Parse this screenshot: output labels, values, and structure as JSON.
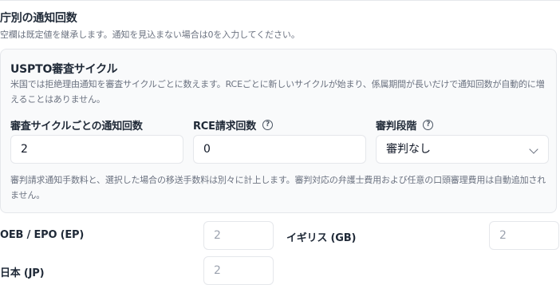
{
  "section": {
    "title": "庁別の通知回数",
    "subtitle": "空欄は既定値を継承します。通知を見込まない場合は0を入力してください。"
  },
  "uspto": {
    "title": "USPTO審査サイクル",
    "description": "米国では拒絶理由通知を審査サイクルごとに数えます。RCEごとに新しいサイクルが始まり、係属期間が長いだけで通知回数が自動的に増えることはありません。",
    "fields": {
      "per_cycle": {
        "label": "審査サイクルごとの通知回数",
        "value": "2"
      },
      "rce": {
        "label": "RCE請求回数",
        "value": "0",
        "help_icon": "question-circle"
      },
      "appeal": {
        "label": "審判段階",
        "selected": "審判なし",
        "help_icon": "question-circle"
      }
    },
    "note": "審判請求通知手数料と、選択した場合の移送手数料は別々に計上します。審判対応の弁護士費用および任意の口頭審理費用は自動追加されません。"
  },
  "offices": [
    {
      "label": "OEB / EPO (EP)",
      "placeholder": "2"
    },
    {
      "label": "イギリス (GB)",
      "placeholder": "2"
    },
    {
      "label": "日本 (JP)",
      "placeholder": "2"
    }
  ]
}
